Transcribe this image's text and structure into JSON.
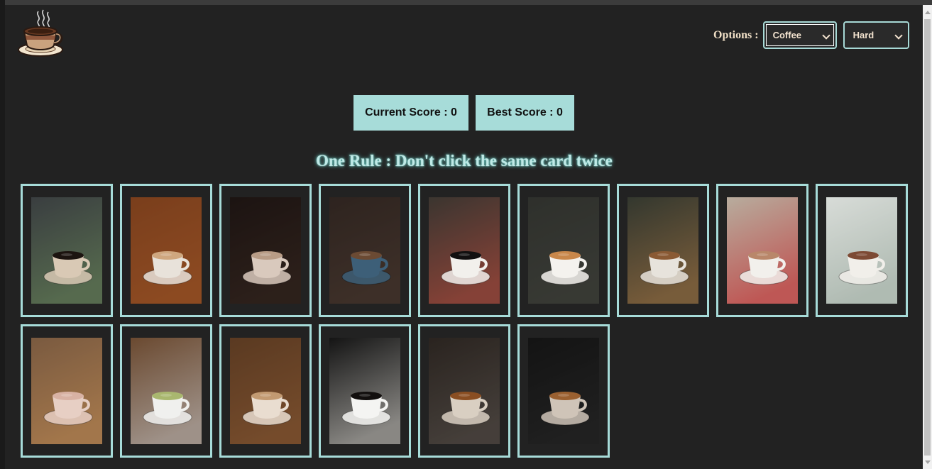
{
  "header": {
    "logo_icon": "coffee-cup-logo",
    "options_label": "Options :",
    "category_select": {
      "selected": "Coffee"
    },
    "difficulty_select": {
      "selected": "Hard"
    }
  },
  "scores": {
    "current": "Current Score : 0",
    "best": "Best Score : 0"
  },
  "rule_text": "One Rule : Don't click the same card twice",
  "cards": [
    {
      "name": "card-coffee-plant-plate",
      "bg": "#3a3e40",
      "accent": "#6e8f5a",
      "cup": "#d9c9b5",
      "liquid": "#1c1410"
    },
    {
      "name": "card-latte-art-saucer",
      "bg": "#7a3f1c",
      "accent": "#9b5426",
      "cup": "#e8e2da",
      "liquid": "#cfa77f"
    },
    {
      "name": "card-iced-latte-glass",
      "bg": "#1c1412",
      "accent": "#3a2a22",
      "cup": "#d9c9bd",
      "liquid": "#b89c86"
    },
    {
      "name": "card-cappuccino-blue-cup",
      "bg": "#2e2420",
      "accent": "#4a3a30",
      "cup": "#3d5f78",
      "liquid": "#6b4a33"
    },
    {
      "name": "card-black-coffee-notebook",
      "bg": "#3b3630",
      "accent": "#c24c3c",
      "cup": "#f2f0ec",
      "liquid": "#121010"
    },
    {
      "name": "card-espresso-white-cup",
      "bg": "#2f302c",
      "accent": "#3f403a",
      "cup": "#f4f2ee",
      "liquid": "#c8874a"
    },
    {
      "name": "card-cortado-wood-table",
      "bg": "#34382f",
      "accent": "#b07a44",
      "cup": "#e7e3dc",
      "liquid": "#8a5a34"
    },
    {
      "name": "card-mocha-poinsettia",
      "bg": "#b8ac9e",
      "accent": "#c4121a",
      "cup": "#f2f0ec",
      "liquid": "#b9876a"
    },
    {
      "name": "card-hot-chocolate-pour",
      "bg": "#d8dcd8",
      "accent": "#8fa094",
      "cup": "#f1efea",
      "liquid": "#7d4a34"
    },
    {
      "name": "card-pink-latte-cafe",
      "bg": "#7a5a40",
      "accent": "#c48d54",
      "cup": "#e7cfc4",
      "liquid": "#d8b2a4"
    },
    {
      "name": "card-matcha-laptop",
      "bg": "#6b4a30",
      "accent": "#c9cccf",
      "cup": "#f0f0ee",
      "liquid": "#a9b76f"
    },
    {
      "name": "card-iced-coffee-jar",
      "bg": "#5a3a22",
      "accent": "#8a5a34",
      "cup": "#e9ddd0",
      "liquid": "#c29a72"
    },
    {
      "name": "card-black-coffee-shadow",
      "bg": "#151515",
      "accent": "#e9e6df",
      "cup": "#f4f4f2",
      "liquid": "#120f0e"
    },
    {
      "name": "card-tea-glass-leaves",
      "bg": "#2a2420",
      "accent": "#5b5550",
      "cup": "#d9cfc2",
      "liquid": "#8a4e22"
    },
    {
      "name": "card-iced-latte-dark",
      "bg": "#141414",
      "accent": "#2a2a2a",
      "cup": "#cfc4b8",
      "liquid": "#9a6030"
    }
  ]
}
